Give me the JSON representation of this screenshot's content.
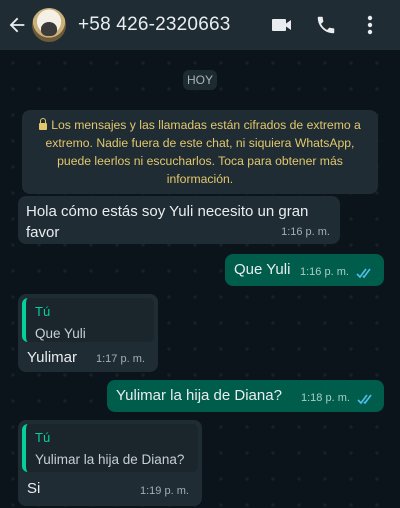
{
  "header": {
    "contact_name": "+58 426-2320663",
    "icons": [
      "back-arrow-icon",
      "avatar",
      "video-call-icon",
      "phone-icon",
      "more-options-icon"
    ]
  },
  "chat": {
    "date_chip": "HOY",
    "encryption_notice": "Los mensajes y las llamadas están cifrados de extremo a extremo. Nadie fuera de este chat, ni siquiera WhatsApp, puede leerlos ni escucharlos. Toca para obtener más información.",
    "messages": [
      {
        "direction": "in",
        "text": "Hola cómo estás soy Yuli necesito un gran favor",
        "time": "1:16 p. m."
      },
      {
        "direction": "out",
        "text": "Que Yuli",
        "time": "1:16 p. m.",
        "status": "read"
      },
      {
        "direction": "in",
        "quote_author": "Tú",
        "quote_text": "Que Yuli",
        "text": "Yulimar",
        "time": "1:17 p. m."
      },
      {
        "direction": "out",
        "text": "Yulimar la hija de Diana?",
        "time": "1:18 p. m.",
        "status": "read"
      },
      {
        "direction": "in",
        "quote_author": "Tú",
        "quote_text": "Yulimar la hija de Diana?",
        "text": "Si",
        "time": "1:19 p. m."
      }
    ]
  },
  "colors": {
    "header_bg": "#1f2c34",
    "chat_bg": "#0b141a",
    "incoming_bubble": "#1f2c34",
    "outgoing_bubble": "#005c4b",
    "notice_text": "#e3c76d",
    "quote_accent": "#06cf9c",
    "read_ticks": "#53bdeb"
  }
}
